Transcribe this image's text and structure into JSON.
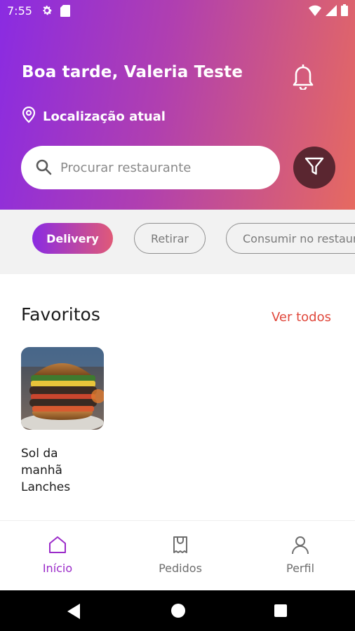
{
  "status_bar": {
    "time": "7:55",
    "icons": [
      "gear-icon",
      "sd-card-icon",
      "wifi-icon",
      "signal-icon",
      "battery-icon"
    ]
  },
  "header": {
    "greeting": "Boa tarde, Valeria Teste",
    "location_label": "Localização atual",
    "icons": [
      "bell-icon",
      "location-pin-icon",
      "search-icon",
      "filter-icon"
    ]
  },
  "search": {
    "placeholder": "Procurar restaurante",
    "value": ""
  },
  "service_chips": [
    {
      "label": "Delivery",
      "selected": true
    },
    {
      "label": "Retirar",
      "selected": false
    },
    {
      "label": "Consumir no restaurante",
      "selected": false
    }
  ],
  "favorites": {
    "title": "Favoritos",
    "see_all": "Ver todos",
    "items": [
      {
        "name": "Sol da manhã Lanches",
        "image": "burger-photo"
      }
    ]
  },
  "bottom_nav": {
    "items": [
      {
        "label": "Início",
        "icon": "home-icon",
        "active": true
      },
      {
        "label": "Pedidos",
        "icon": "receipt-icon",
        "active": false
      },
      {
        "label": "Perfil",
        "icon": "user-icon",
        "active": false
      }
    ]
  },
  "colors": {
    "gradient_start": "#8a2be2",
    "gradient_end": "#e66a60",
    "filter_button": "#5a2630",
    "active_nav": "#9b2bc9",
    "see_all": "#e0483c"
  }
}
